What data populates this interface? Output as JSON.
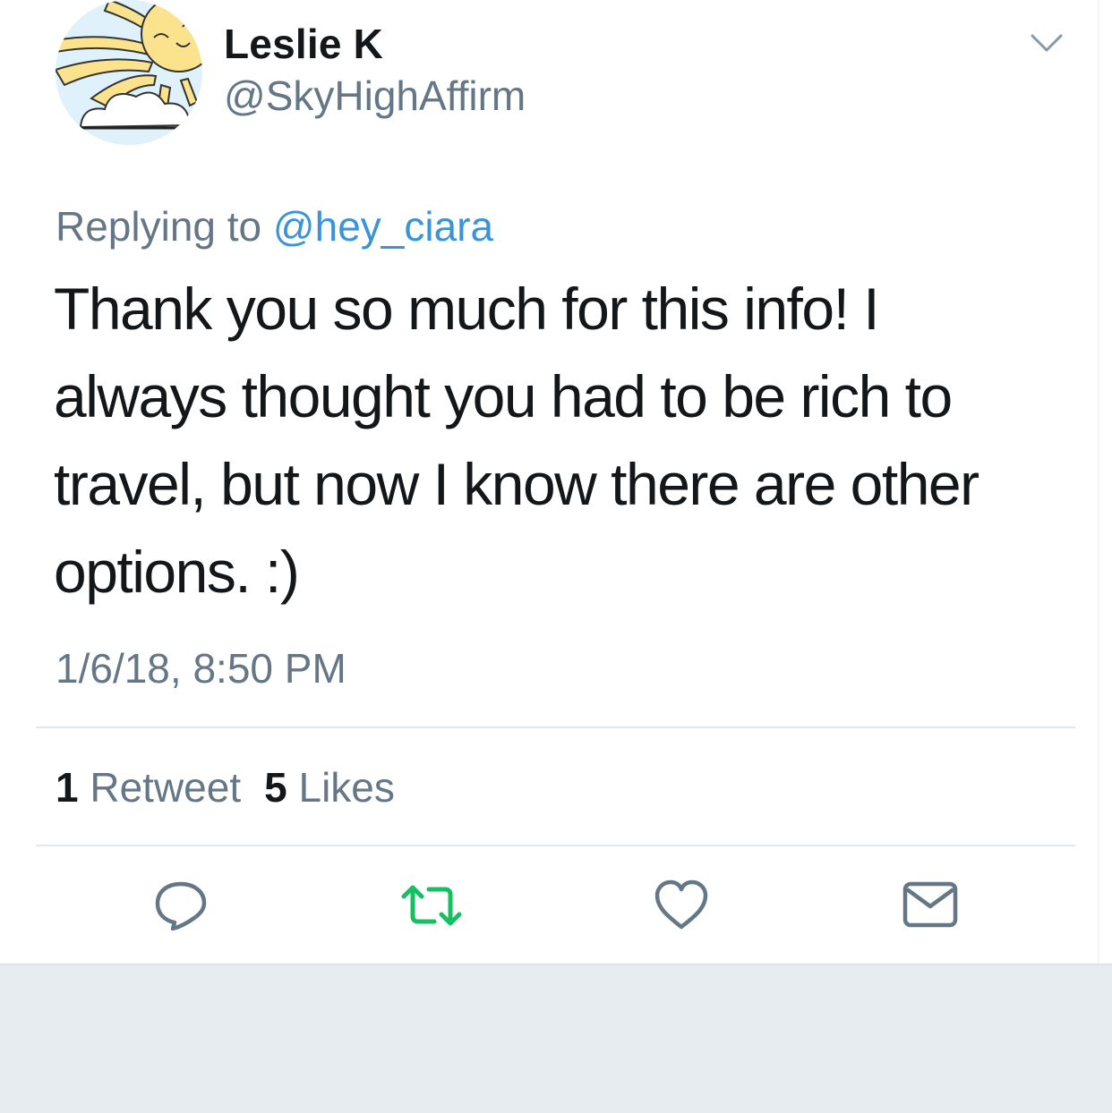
{
  "user": {
    "display_name": "Leslie K",
    "handle": "@SkyHighAffirm"
  },
  "reply": {
    "prefix": "Replying to",
    "mention": "@hey_ciara"
  },
  "tweet": {
    "text": "Thank you so much for this info! I always thought you had to be rich to travel, but now I know there are other options. :)",
    "timestamp": "1/6/18, 8:50 PM"
  },
  "stats": {
    "retweet_count": "1",
    "retweet_label": "Retweet",
    "like_count": "5",
    "like_label": "Likes"
  },
  "icons": {
    "reply": "reply-icon",
    "retweet": "retweet-icon",
    "like": "heart-icon",
    "dm": "envelope-icon",
    "menu": "chevron-down-icon"
  },
  "colors": {
    "text": "#14171a",
    "secondary": "#657786",
    "link": "#3b94d9",
    "retweet_green": "#17bf63",
    "divider": "#e1e8ed",
    "background_below": "#e6ecf0"
  }
}
